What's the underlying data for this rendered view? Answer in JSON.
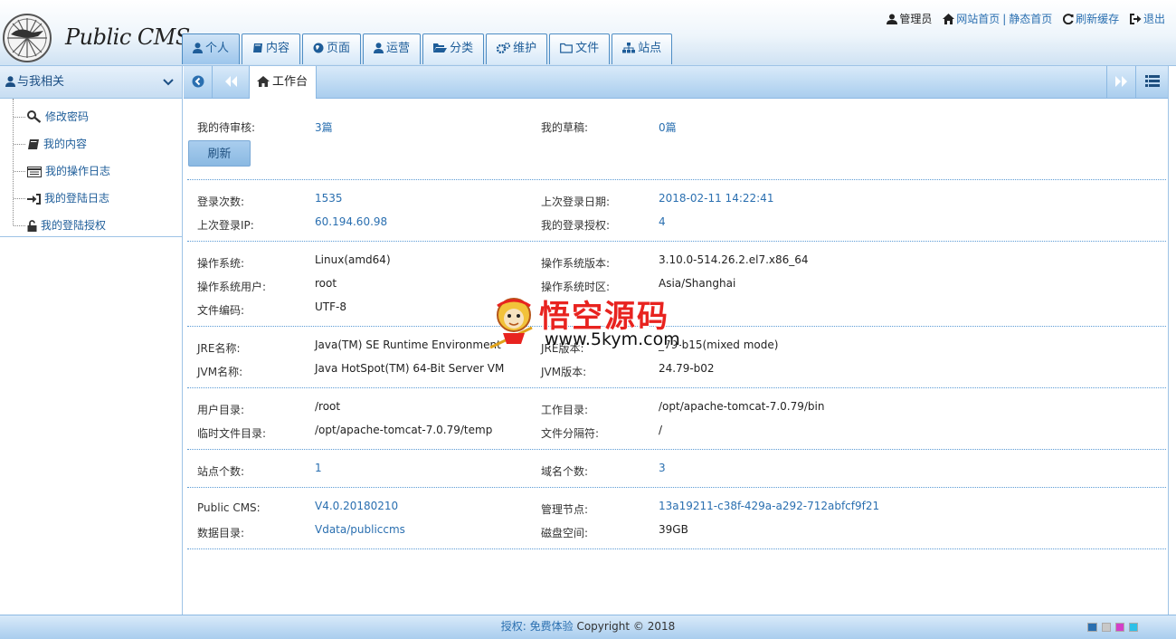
{
  "header": {
    "logo_text": "Public CMS",
    "top_links": {
      "user": "管理员",
      "site_home": "网站首页",
      "separator": "|",
      "static_home": "静态首页",
      "refresh_cache": "刷新缓存",
      "logout": "退出"
    },
    "nav_tabs": [
      {
        "label": "个人",
        "icon": "user-icon",
        "active": true
      },
      {
        "label": "内容",
        "icon": "book-icon"
      },
      {
        "label": "页面",
        "icon": "globe-icon"
      },
      {
        "label": "运营",
        "icon": "user-icon"
      },
      {
        "label": "分类",
        "icon": "folder-open-icon"
      },
      {
        "label": "维护",
        "icon": "gears-icon"
      },
      {
        "label": "文件",
        "icon": "folder-icon"
      },
      {
        "label": "站点",
        "icon": "sitemap-icon"
      }
    ]
  },
  "sidebar": {
    "title": "与我相关",
    "items": [
      {
        "label": "修改密码",
        "icon": "key-icon"
      },
      {
        "label": "我的内容",
        "icon": "book-icon"
      },
      {
        "label": "我的操作日志",
        "icon": "list-icon"
      },
      {
        "label": "我的登陆日志",
        "icon": "sign-in-icon"
      },
      {
        "label": "我的登陆授权",
        "icon": "lock-icon"
      }
    ]
  },
  "tabbar": {
    "active_tab": "工作台"
  },
  "dashboard": {
    "refresh_button": "刷新",
    "sections": [
      {
        "rows": [
          {
            "l1": "我的待审核:",
            "v1": "3篇",
            "l2": "我的草稿:",
            "v2": "0篇"
          }
        ]
      },
      {
        "rows": [
          {
            "l1": "登录次数:",
            "v1": "1535",
            "l2": "上次登录日期:",
            "v2": "2018-02-11 14:22:41"
          },
          {
            "l1": "上次登录IP:",
            "v1": "60.194.60.98",
            "l2": "我的登录授权:",
            "v2": "4"
          }
        ]
      },
      {
        "rows": [
          {
            "l1": "操作系统:",
            "v1": "Linux(amd64)",
            "l2": "操作系统版本:",
            "v2": "3.10.0-514.26.2.el7.x86_64"
          },
          {
            "l1": "操作系统用户:",
            "v1": "root",
            "l2": "操作系统时区:",
            "v2": "Asia/Shanghai"
          },
          {
            "l1": "文件编码:",
            "v1": "UTF-8",
            "l2": "",
            "v2": ""
          }
        ]
      },
      {
        "rows": [
          {
            "l1": "JRE名称:",
            "v1": "Java(TM) SE Runtime Environment",
            "l2": "JRE版本:",
            "v2": "_79-b15(mixed mode)"
          },
          {
            "l1": "JVM名称:",
            "v1": "Java HotSpot(TM) 64-Bit Server VM",
            "l2": "JVM版本:",
            "v2": "24.79-b02"
          }
        ]
      },
      {
        "rows": [
          {
            "l1": "用户目录:",
            "v1": "/root",
            "l2": "工作目录:",
            "v2": "/opt/apache-tomcat-7.0.79/bin"
          },
          {
            "l1": "临时文件目录:",
            "v1": "/opt/apache-tomcat-7.0.79/temp",
            "l2": "文件分隔符:",
            "v2": "/"
          }
        ]
      },
      {
        "rows": [
          {
            "l1": "站点个数:",
            "v1": "1",
            "l2": "域名个数:",
            "v2": "3"
          }
        ]
      },
      {
        "rows": [
          {
            "l1": "Public CMS:",
            "v1": "V4.0.20180210",
            "l2": "管理节点:",
            "v2": "13a19211-c38f-429a-a292-712abfcf9f21"
          },
          {
            "l1": "数据目录:",
            "v1": "Vdata/publiccms",
            "l2": "磁盘空间:",
            "v2": "39GB"
          }
        ]
      }
    ]
  },
  "footer": {
    "license_label": "授权:",
    "license_value": "免费体验",
    "copyright": "Copyright © 2018"
  },
  "watermark": {
    "title": "悟空源码",
    "url": "www.5kym.com"
  },
  "colors": {
    "accent": "#2a6fb0",
    "border": "#9ec3e6",
    "bar": "#a9cdee"
  }
}
